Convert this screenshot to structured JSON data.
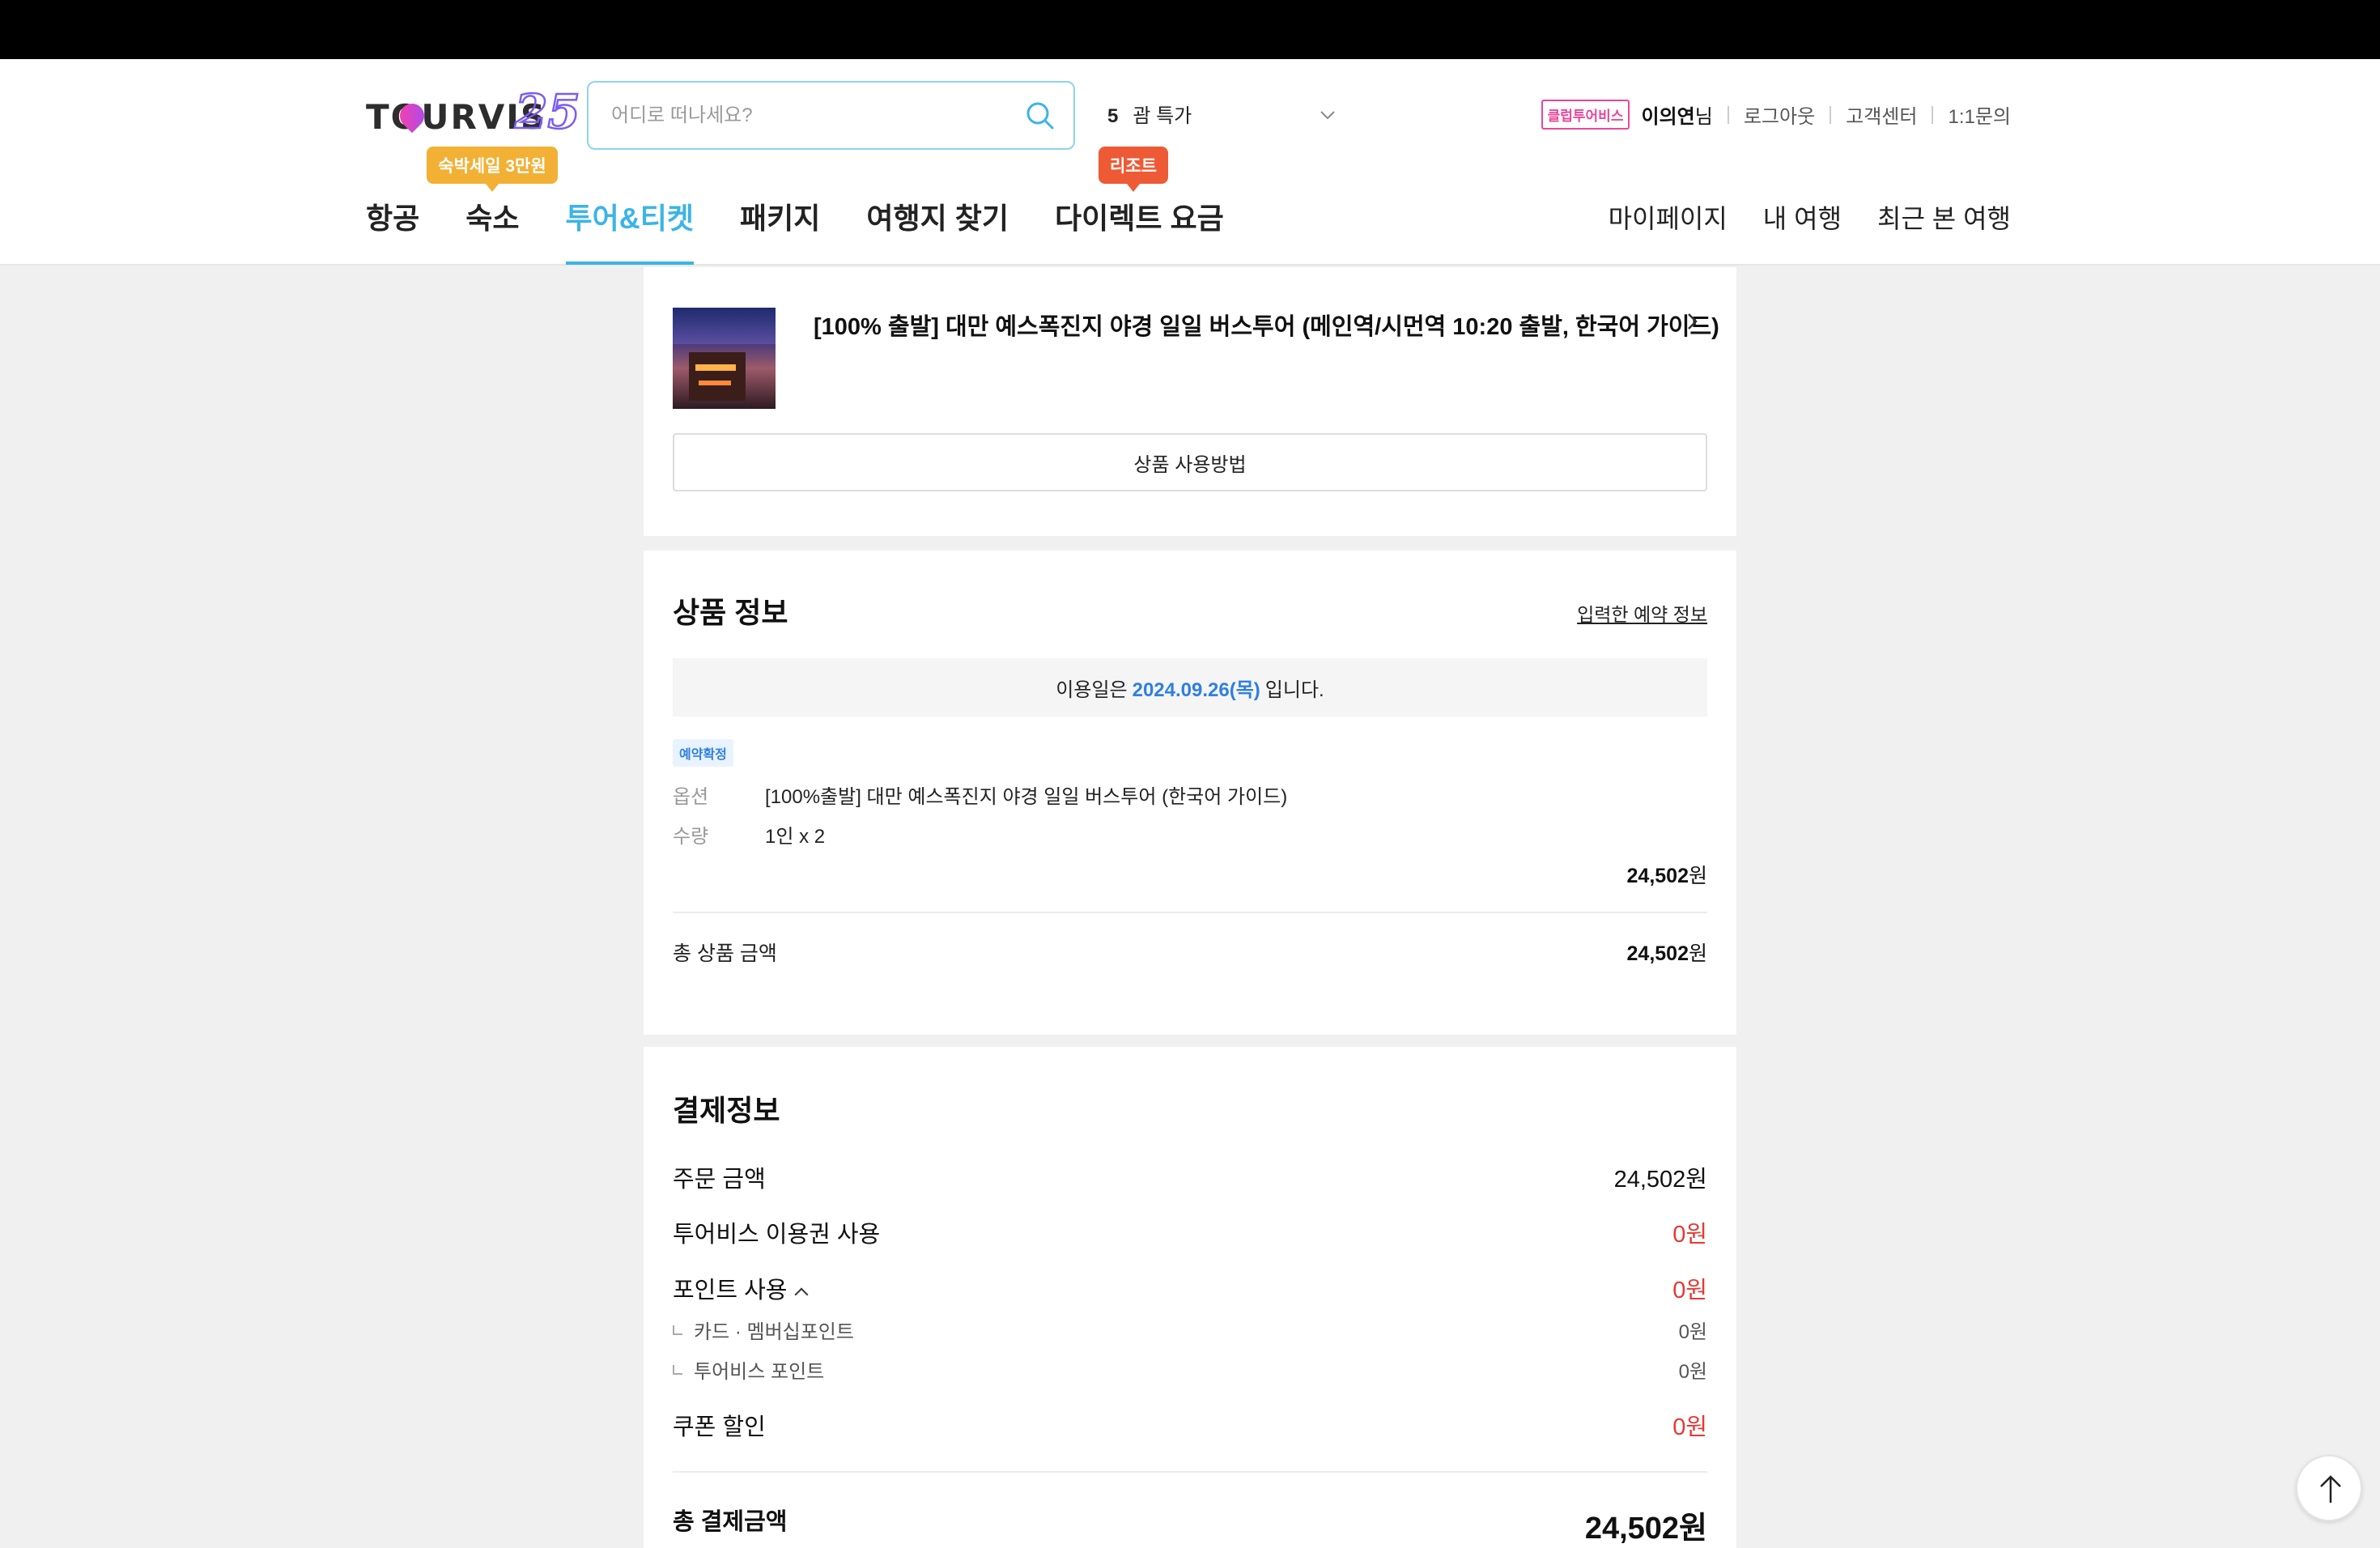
{
  "header": {
    "logo": "TOURVIS 25",
    "search_placeholder": "어디로 떠나세요?",
    "promo_num": "5",
    "promo_text": "괌 특가",
    "club_badge": "클럽투어비스",
    "user_name": "이의연",
    "user_suffix": "님",
    "logout": "로그아웃",
    "customer_center": "고객센터",
    "inquiry": "1:1문의"
  },
  "nav": {
    "items": [
      "항공",
      "숙소",
      "투어&티켓",
      "패키지",
      "여행지 찾기",
      "다이렉트 요금"
    ],
    "active_index": 2,
    "bubble_lodging": "숙박세일 3만원",
    "bubble_direct": "리조트",
    "right_items": [
      "마이페이지",
      "내 여행",
      "최근 본 여행"
    ]
  },
  "product": {
    "title": "[100% 출발] 대만 예스폭진지 야경 일일 버스투어 (메인역/시먼역 10:20 출발, 한국어 가이드)",
    "usage_button": "상품 사용방법"
  },
  "product_info": {
    "title": "상품 정보",
    "reservation_link": "입력한 예약 정보",
    "date_prefix": "이용일은",
    "date": "2024.09.26(목)",
    "date_suffix": "입니다.",
    "status": "예약확정",
    "option_label": "옵션",
    "option_value": "[100%출발] 대만 예스폭진지 야경 일일 버스투어 (한국어 가이드)",
    "qty_label": "수량",
    "qty_value": "1인 x 2",
    "price": "24,502",
    "won": "원",
    "total_label": "총 상품 금액",
    "total_price": "24,502"
  },
  "payment": {
    "title": "결제정보",
    "order_label": "주문 금액",
    "order_amount": "24,502원",
    "voucher_label": "투어비스 이용권 사용",
    "voucher_amount": "0원",
    "point_label": "포인트 사용",
    "point_amount": "0원",
    "card_point_label": "카드 · 멤버십포인트",
    "card_point_amount": "0원",
    "tourvis_point_label": "투어비스 포인트",
    "tourvis_point_amount": "0원",
    "coupon_label": "쿠폰 할인",
    "coupon_amount": "0원",
    "final_label": "총 결제금액",
    "final_amount": "24,502원"
  },
  "colors": {
    "accent": "#3cb4e6",
    "date_blue": "#2f7fe0",
    "discount_red": "#e53935",
    "bubble_yellow": "#f2b035",
    "bubble_red": "#ee5a35"
  }
}
